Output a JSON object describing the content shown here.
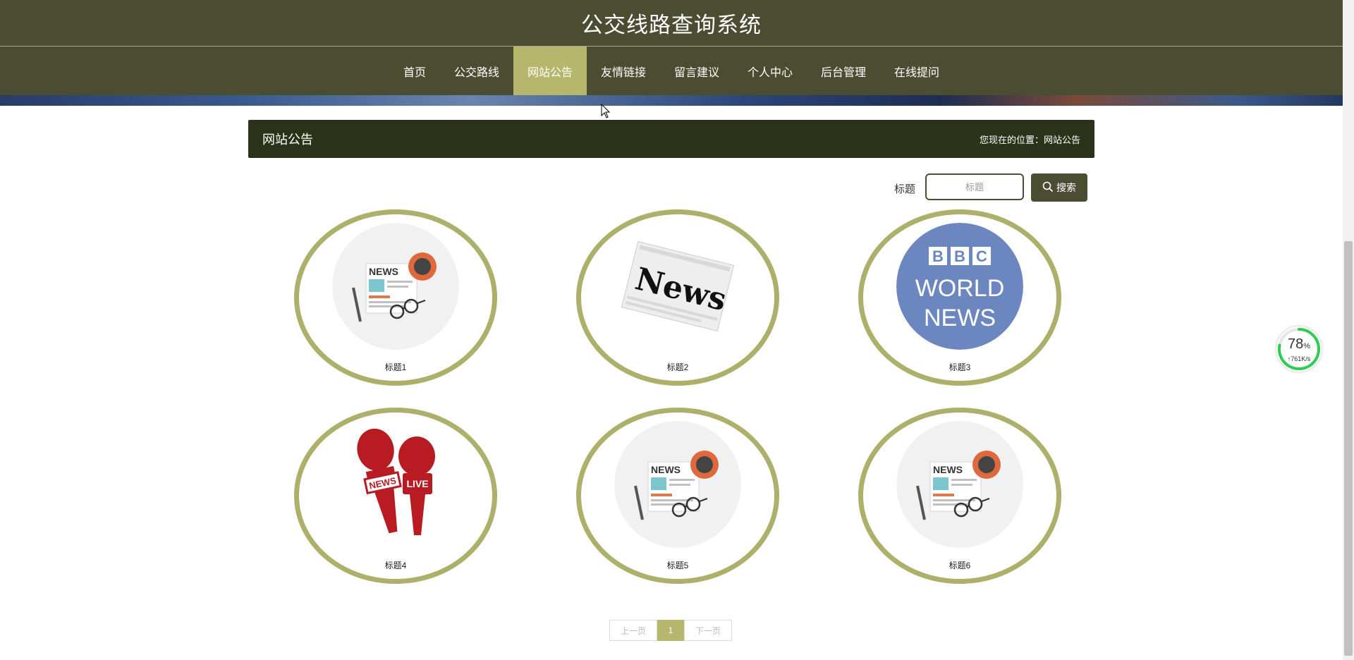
{
  "header": {
    "site_title": "公交线路查询系统"
  },
  "nav": {
    "items": [
      {
        "label": "首页"
      },
      {
        "label": "公交路线"
      },
      {
        "label": "网站公告",
        "active": true
      },
      {
        "label": "友情链接"
      },
      {
        "label": "留言建议"
      },
      {
        "label": "个人中心"
      },
      {
        "label": "后台管理"
      },
      {
        "label": "在线提问"
      }
    ]
  },
  "section": {
    "title": "网站公告",
    "breadcrumb": "您现在的位置：网站公告"
  },
  "search": {
    "label": "标题",
    "placeholder": "标题",
    "value": "",
    "button_label": "搜索",
    "button_icon": "search-icon"
  },
  "cards": [
    {
      "title": "标题1",
      "image": "newspaper-icon"
    },
    {
      "title": "标题2",
      "image": "news-paper-photo"
    },
    {
      "title": "标题3",
      "image": "bbc-world-news-logo",
      "logo_text": [
        "BBC",
        "WORLD",
        "NEWS"
      ]
    },
    {
      "title": "标题4",
      "image": "news-microphones-icon",
      "mic_labels": [
        "NEWS",
        "LIVE"
      ]
    },
    {
      "title": "标题5",
      "image": "newspaper-icon"
    },
    {
      "title": "标题6",
      "image": "newspaper-icon"
    }
  ],
  "pagination": {
    "prev": "上一页",
    "current": "1",
    "next": "下一页"
  },
  "speed_widget": {
    "percent": "78",
    "percent_sign": "%",
    "rate": "↑761K/s",
    "level": 0.78
  },
  "colors": {
    "header_bg": "#4b4d33",
    "nav_active": "#b6b66c",
    "section_bar": "#2c3219",
    "card_border": "#adb06a"
  }
}
